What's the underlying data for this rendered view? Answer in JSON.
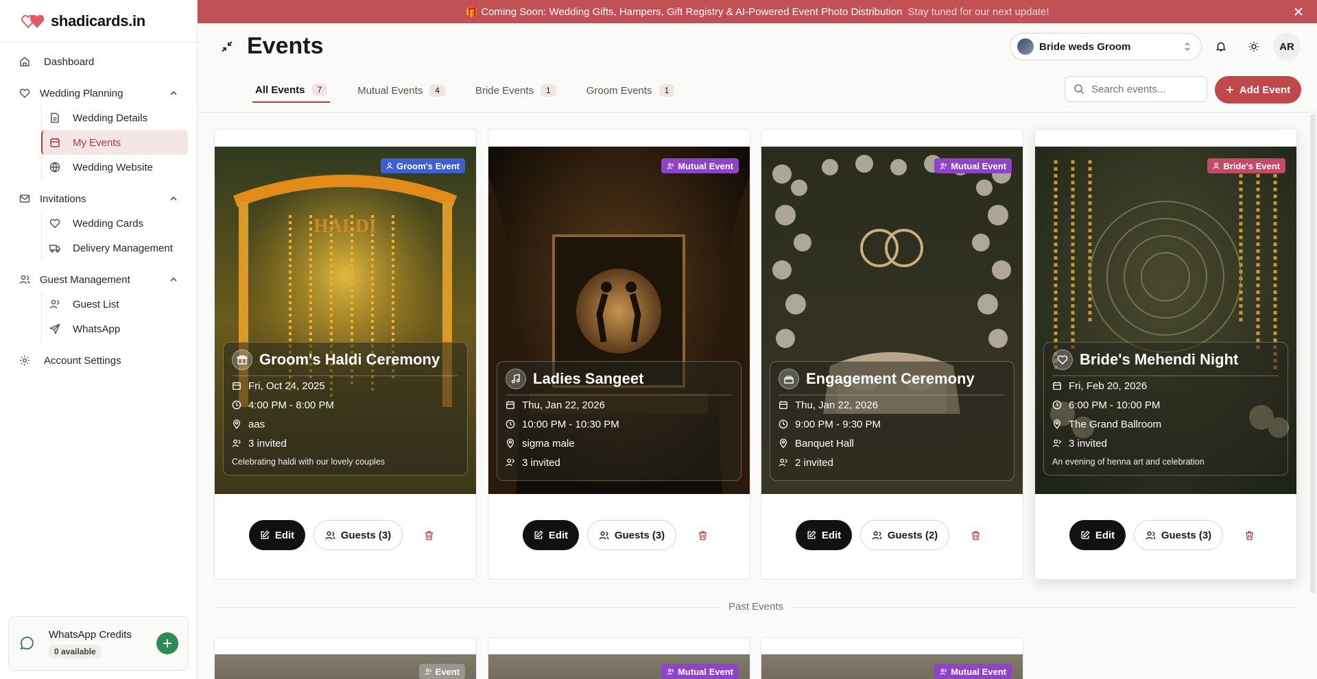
{
  "brand": {
    "name": "shadicards.in"
  },
  "sidebar": {
    "dashboard": "Dashboard",
    "groups": [
      {
        "label": "Wedding Planning",
        "items": [
          "Wedding Details",
          "My Events",
          "Wedding Website"
        ]
      },
      {
        "label": "Invitations",
        "items": [
          "Wedding Cards",
          "Delivery Management"
        ]
      },
      {
        "label": "Guest Management",
        "items": [
          "Guest List",
          "WhatsApp"
        ]
      }
    ],
    "account": "Account Settings",
    "credits": {
      "title": "WhatsApp Credits",
      "available": "0 available"
    }
  },
  "banner": {
    "text": "🎁 Coming Soon: Wedding Gifts, Hampers, Gift Registry & AI-Powered Event Photo Distribution",
    "note": "Stay tuned for our next update!"
  },
  "header": {
    "title": "Events",
    "couple": "Bride weds Groom",
    "avatar": "AR",
    "search_placeholder": "Search events...",
    "add_label": "Add Event",
    "tabs": [
      {
        "label": "All Events",
        "count": "7"
      },
      {
        "label": "Mutual Events",
        "count": "4"
      },
      {
        "label": "Bride Events",
        "count": "1"
      },
      {
        "label": "Groom Events",
        "count": "1"
      }
    ]
  },
  "events": [
    {
      "tag": "Groom's Event",
      "tag_type": "groom",
      "icon": "gift",
      "title": "Groom's Haldi Ceremony",
      "date": "Fri, Oct 24, 2025",
      "time": "4:00 PM - 8:00 PM",
      "venue": "aas",
      "invited": "3 invited",
      "desc": "Celebrating haldi with our lovely couples",
      "edit": "Edit",
      "guests": "Guests (3)",
      "theme": "haldi"
    },
    {
      "tag": "Mutual Event",
      "tag_type": "mutual",
      "icon": "music",
      "title": "Ladies Sangeet",
      "date": "Thu, Jan 22, 2026",
      "time": "10:00 PM - 10:30 PM",
      "venue": "sigma male",
      "invited": "3 invited",
      "desc": "",
      "edit": "Edit",
      "guests": "Guests (3)",
      "theme": "sangeet"
    },
    {
      "tag": "Mutual Event",
      "tag_type": "mutual",
      "icon": "cake",
      "title": "Engagement Ceremony",
      "date": "Thu, Jan 22, 2026",
      "time": "9:00 PM - 9:30 PM",
      "venue": "Banquet Hall",
      "invited": "2 invited",
      "desc": "",
      "edit": "Edit",
      "guests": "Guests (2)",
      "theme": "engagement"
    },
    {
      "tag": "Bride's Event",
      "tag_type": "bride",
      "icon": "heart",
      "title": "Bride's Mehendi Night",
      "date": "Fri, Feb 20, 2026",
      "time": "6:00 PM - 10:00 PM",
      "venue": "The Grand Ballroom",
      "invited": "3 invited",
      "desc": "An evening of henna art and celebration",
      "edit": "Edit",
      "guests": "Guests (3)",
      "theme": "mehendi"
    }
  ],
  "past": {
    "label": "Past Events",
    "tags": [
      "Event",
      "Mutual Event",
      "Mutual Event"
    ]
  },
  "colors": {
    "accent": "#c0474b",
    "groom": "#3d5fd1",
    "mutual": "#8e44c7",
    "bride": "#c44a6a"
  }
}
